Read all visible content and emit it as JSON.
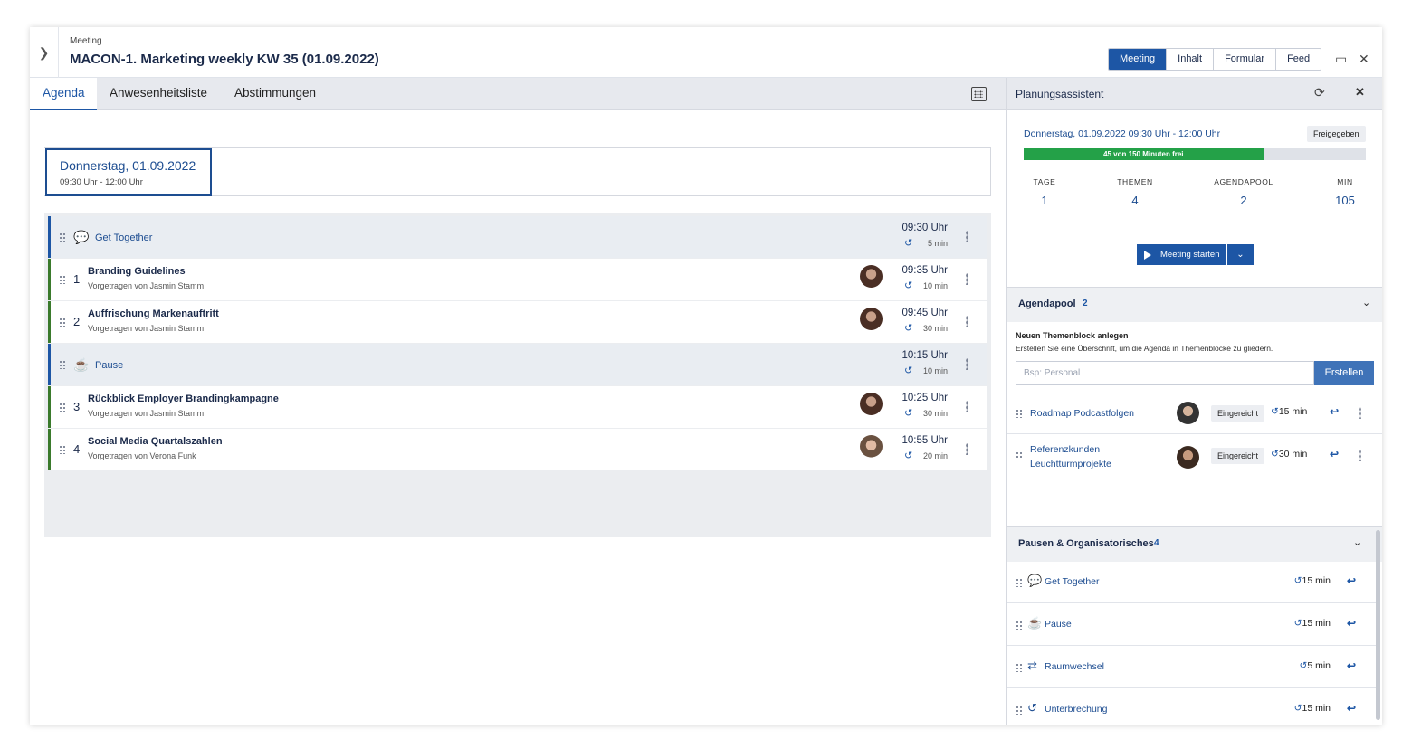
{
  "window": {
    "subtitle": "Meeting",
    "title": "MACON-1. Marketing weekly KW 35 (01.09.2022)",
    "view_tabs": [
      "Meeting",
      "Inhalt",
      "Formular",
      "Feed"
    ],
    "active_view": "Meeting"
  },
  "tabs": [
    "Agenda",
    "Anwesenheitsliste",
    "Abstimmungen"
  ],
  "day": {
    "label": "Donnerstag, 01.09.2022",
    "time": "09:30 Uhr - 12:00 Uhr"
  },
  "agenda": [
    {
      "type": "block",
      "icon": "chat-icon",
      "icon_glyph": "💬",
      "title": "Get Together",
      "time": "09:30 Uhr",
      "duration": "5 min"
    },
    {
      "type": "item",
      "num": "1",
      "title": "Branding Guidelines",
      "presenter": "Vorgetragen von Jasmin Stamm",
      "time": "09:35 Uhr",
      "duration": "10 min"
    },
    {
      "type": "item",
      "num": "2",
      "title": "Auffrischung Markenauftritt",
      "presenter": "Vorgetragen von Jasmin Stamm",
      "time": "09:45 Uhr",
      "duration": "30 min"
    },
    {
      "type": "block",
      "icon": "coffee-icon",
      "icon_glyph": "☕",
      "title": "Pause",
      "time": "10:15 Uhr",
      "duration": "10 min"
    },
    {
      "type": "item",
      "num": "3",
      "title": "Rückblick Employer Brandingkampagne",
      "presenter": "Vorgetragen von Jasmin Stamm",
      "time": "10:25 Uhr",
      "duration": "30 min"
    },
    {
      "type": "item",
      "num": "4",
      "title": "Social Media Quartalszahlen",
      "presenter": "Vorgetragen von Verona Funk",
      "time": "10:55 Uhr",
      "duration": "20 min"
    }
  ],
  "planner": {
    "title": "Planungsassistent",
    "date": "Donnerstag, 01.09.2022 09:30 Uhr - 12:00 Uhr",
    "status": "Freigegeben",
    "progress_label": "45 von 150 Minuten frei",
    "progress_fraction": 0.7,
    "stats": [
      {
        "label": "TAGE",
        "value": "1"
      },
      {
        "label": "THEMEN",
        "value": "4"
      },
      {
        "label": "AGENDAPOOL",
        "value": "2"
      },
      {
        "label": "MIN",
        "value": "105"
      }
    ],
    "start_button": "Meeting starten"
  },
  "agendapool": {
    "title": "Agendapool",
    "count": "2",
    "new_block_title": "Neuen Themenblock anlegen",
    "new_block_hint": "Erstellen Sie eine Überschrift, um die Agenda in Themenblöcke zu gliedern.",
    "input_placeholder": "Bsp: Personal",
    "create_button": "Erstellen",
    "items": [
      {
        "title": "Roadmap Podcastfolgen",
        "status": "Eingereicht",
        "duration": "15 min"
      },
      {
        "title": "Referenzkunden Leuchtturmprojekte",
        "status": "Eingereicht",
        "duration": "30 min"
      }
    ]
  },
  "organisational": {
    "title": "Pausen & Organisatorisches",
    "count": "4",
    "items": [
      {
        "icon": "chat-icon",
        "icon_glyph": "💬",
        "title": "Get Together",
        "duration": "15 min"
      },
      {
        "icon": "coffee-icon",
        "icon_glyph": "☕",
        "title": "Pause",
        "duration": "15 min"
      },
      {
        "icon": "swap-icon",
        "icon_glyph": "⇄",
        "title": "Raumwechsel",
        "duration": "5 min"
      },
      {
        "icon": "history-icon",
        "icon_glyph": "↺",
        "title": "Unterbrechung",
        "duration": "15 min"
      }
    ]
  }
}
